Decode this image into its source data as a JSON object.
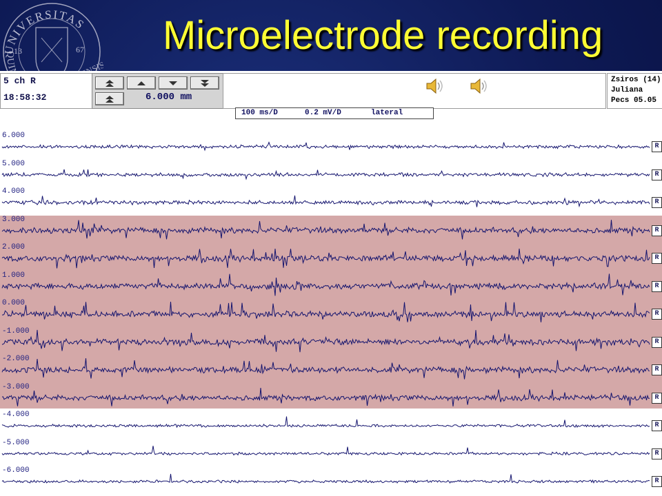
{
  "slide": {
    "title": "Microelectrode recording",
    "logo": {
      "text_top": "UNIVERSITAS",
      "text_left": "QUINQUE",
      "text_bottom": "ECCLESIENSIS",
      "num_left": "13",
      "num_right": "67"
    }
  },
  "recorder": {
    "channel_label": "5 ch R",
    "clock": "18:58:32",
    "depth": "6.000 mm",
    "buttons": [
      {
        "name": "top-up",
        "icon": "double-up-arrow-icon"
      },
      {
        "name": "up",
        "icon": "up-arrow-icon"
      },
      {
        "name": "down",
        "icon": "down-arrow-icon"
      },
      {
        "name": "bottom-down",
        "icon": "double-down-arrow-icon"
      },
      {
        "name": "top-up-2",
        "icon": "double-up-arrow-icon"
      }
    ],
    "patient": {
      "line1": "Zsiros (14)",
      "line2": "Juliana",
      "line3": "Pecs  05.05"
    },
    "params": {
      "time_scale": "100 ms/D",
      "amp_scale": "0.2 mV/D",
      "side": "lateral"
    },
    "colors": {
      "trace": "#14146e",
      "highlight": "#d4a8a8",
      "title": "#ffff33"
    },
    "channels": [
      {
        "depth_label": "6.000",
        "marker": "R",
        "amp": 0.35,
        "spikes": true
      },
      {
        "depth_label": "5.000",
        "marker": "R",
        "amp": 0.45,
        "spikes": true
      },
      {
        "depth_label": "4.000",
        "marker": "R",
        "amp": 0.55,
        "spikes": true
      },
      {
        "depth_label": "3.000",
        "marker": "R",
        "amp": 0.9,
        "spikes": true
      },
      {
        "depth_label": "2.000",
        "marker": "R",
        "amp": 0.95,
        "spikes": true
      },
      {
        "depth_label": "1.000",
        "marker": "R",
        "amp": 1.0,
        "spikes": true
      },
      {
        "depth_label": "0.000",
        "marker": "R",
        "amp": 1.0,
        "spikes": true
      },
      {
        "depth_label": "-1.000",
        "marker": "R",
        "amp": 1.0,
        "spikes": true
      },
      {
        "depth_label": "-2.000",
        "marker": "R",
        "amp": 0.95,
        "spikes": true
      },
      {
        "depth_label": "-3.000",
        "marker": "R",
        "amp": 0.85,
        "spikes": true
      },
      {
        "depth_label": "-4.000",
        "marker": "R",
        "amp": 0.25,
        "spikes": false
      },
      {
        "depth_label": "-5.000",
        "marker": "R",
        "amp": 0.22,
        "spikes": false
      },
      {
        "depth_label": "-6.000",
        "marker": "R",
        "amp": 0.22,
        "spikes": false
      }
    ]
  }
}
